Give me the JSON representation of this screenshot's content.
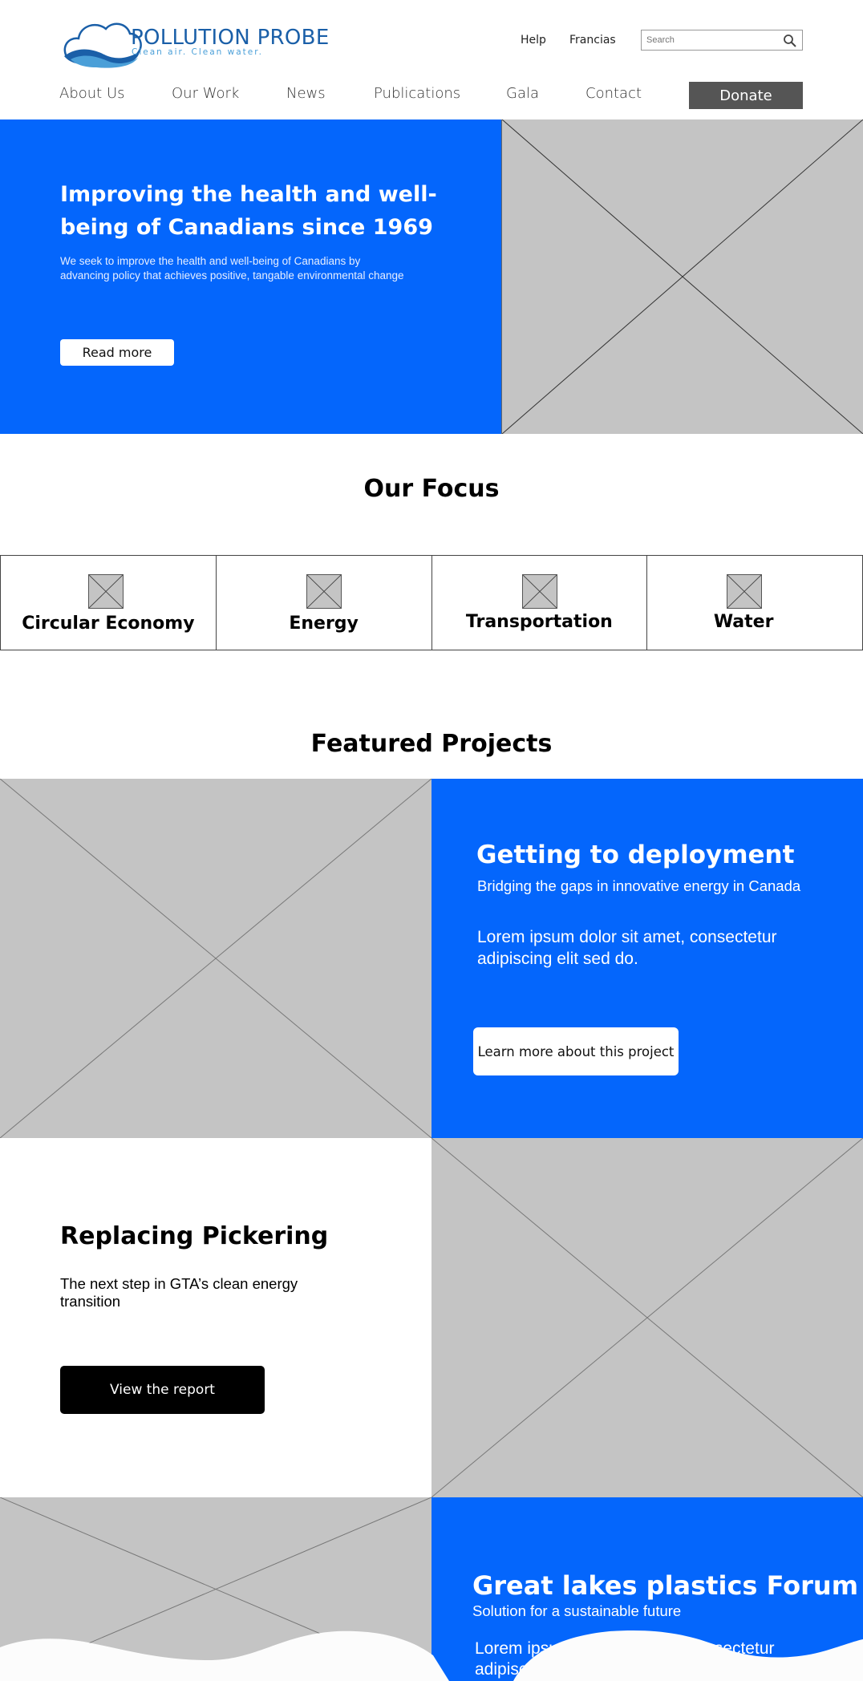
{
  "header": {
    "logo_title": "POLLUTION PROBE",
    "logo_tagline": "Clean air. Clean water.",
    "util_links": [
      "Help",
      "Francias"
    ],
    "search_placeholder": "Search"
  },
  "nav": {
    "items": [
      "About Us",
      "Our Work",
      "News",
      "Publications",
      "Gala",
      "Contact"
    ],
    "donate_label": "Donate"
  },
  "hero": {
    "title": "Improving the health and well-being of Canadians since 1969",
    "text": "We seek to improve the health and well-being of Canadians by advancing policy that achieves positive, tangable environmental change",
    "button_label": "Read more"
  },
  "focus": {
    "title": "Our Focus",
    "items": [
      "Circular Economy",
      "Energy",
      "Transportation",
      "Water"
    ]
  },
  "featured": {
    "title": "Featured Projects",
    "projects": [
      {
        "title": "Getting to deployment",
        "subtitle": "Bridging the gaps in innovative energy in Canada",
        "body": "Lorem ipsum dolor sit amet, consectetur adipiscing elit sed do.",
        "button_label": "Learn more about this project"
      },
      {
        "title": "Replacing Pickering",
        "subtitle": "The next step in GTA’s clean energy transition",
        "button_label": "View the report"
      },
      {
        "title": "Great lakes plastics Forum",
        "subtitle": "Solution for a sustainable future",
        "body": "Lorem ipsum dolor sit amet, consectetur adipiscing elit sed do."
      }
    ]
  },
  "colors": {
    "brand_blue": "#0466fc",
    "logo_blue": "#1a5fa8",
    "placeholder_gray": "#c4c4c4",
    "donate_gray": "#555555"
  }
}
